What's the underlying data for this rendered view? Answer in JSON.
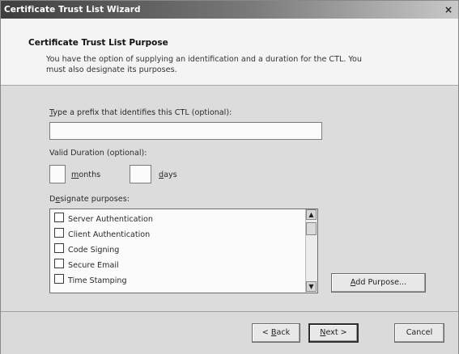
{
  "window": {
    "title": "Certificate Trust List Wizard",
    "close_glyph": "×"
  },
  "header": {
    "title": "Certificate Trust List Purpose",
    "description_line1": "You have the option of supplying an identification and a duration for the CTL. You",
    "description_line2": "must also designate its purposes."
  },
  "prefix": {
    "label_mnemonic": "T",
    "label_rest": "ype a prefix that identifies this CTL (optional):",
    "value": ""
  },
  "duration": {
    "label": "Valid Duration (optional):",
    "months_mnemonic": "m",
    "months_rest": "onths",
    "months_value": "",
    "days_mnemonic": "d",
    "days_rest": "ays",
    "days_value": ""
  },
  "purposes": {
    "label_pre": "D",
    "label_mnemonic": "e",
    "label_rest": "signate purposes:",
    "items": [
      {
        "label": "Server Authentication",
        "checked": false
      },
      {
        "label": "Client Authentication",
        "checked": false
      },
      {
        "label": "Code Signing",
        "checked": false
      },
      {
        "label": "Secure Email",
        "checked": false
      },
      {
        "label": "Time Stamping",
        "checked": false
      }
    ],
    "add_mnemonic": "A",
    "add_rest": "dd Purpose..."
  },
  "footer": {
    "back_pre": "< ",
    "back_mnemonic": "B",
    "back_rest": "ack",
    "next_mnemonic": "N",
    "next_rest": "ext >",
    "cancel_label": "Cancel"
  }
}
